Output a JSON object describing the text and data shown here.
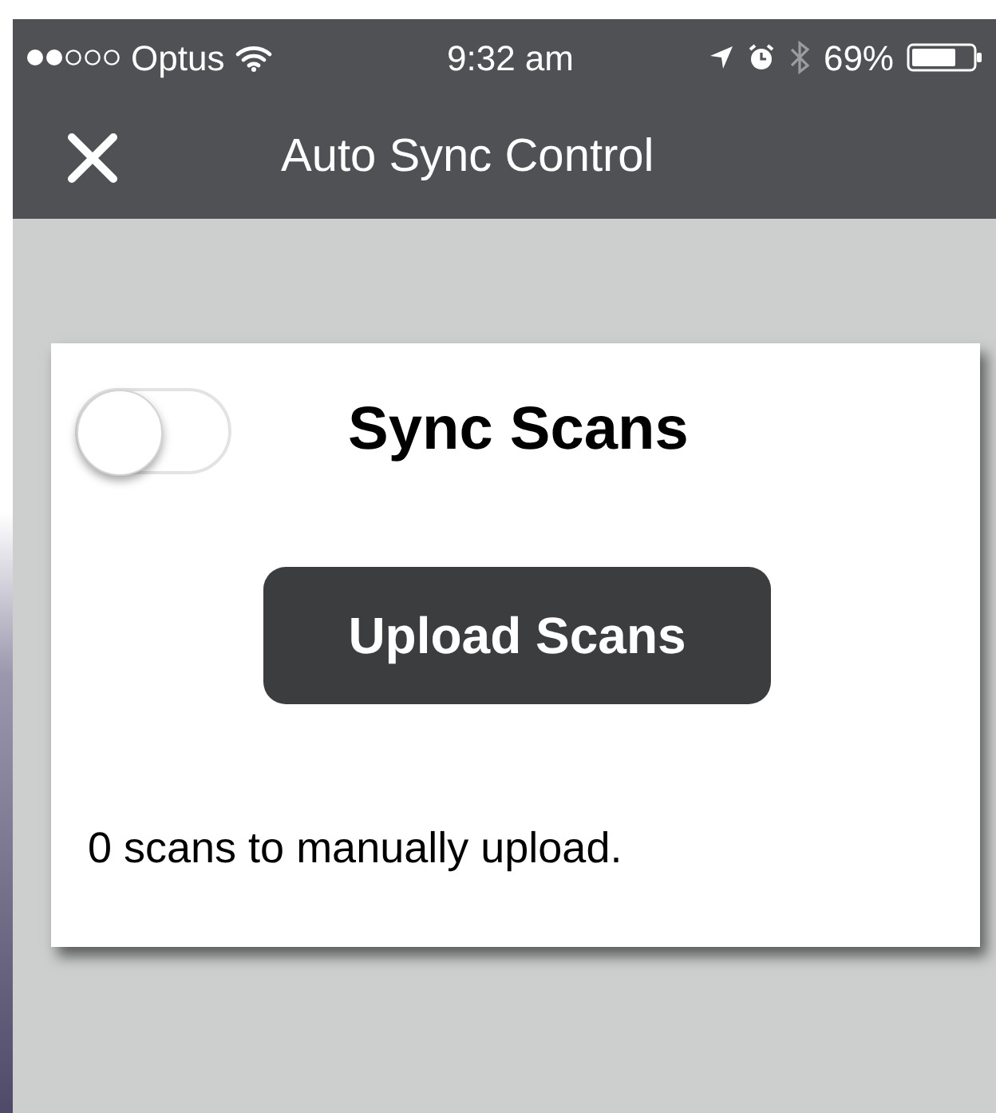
{
  "status_bar": {
    "carrier": "Optus",
    "time": "9:32 am",
    "battery": "69%"
  },
  "nav_bar": {
    "title": "Auto Sync Control"
  },
  "card": {
    "sync_toggle": {
      "on": false
    },
    "title": "Sync Scans",
    "button": "Upload Scans",
    "message": "0 scans to manually upload."
  }
}
